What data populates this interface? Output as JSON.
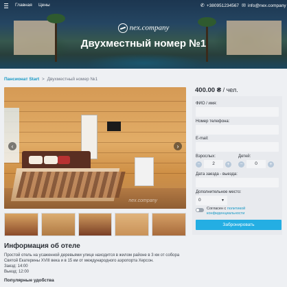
{
  "nav": {
    "home": "Главная",
    "prices": "Цены",
    "phone": "+380951234567",
    "email": "info@nex.company"
  },
  "logo": {
    "text": "nex.company"
  },
  "hero": {
    "title": "Двухместный номер №1"
  },
  "breadcrumb": {
    "link": "Пансионат Start",
    "separator": ">",
    "current": "Двухместный номер №1"
  },
  "gallery": {
    "watermark": "nex.company",
    "prev_icon": "‹",
    "next_icon": "›"
  },
  "booking": {
    "price": "400.00 ₴",
    "per": "/ чел.",
    "name_label": "ФИО / имя:",
    "phone_label": "Номер телефона:",
    "email_label": "E-mail:",
    "adults_label": "Взрослых:",
    "adults_value": "2",
    "children_label": "Детей:",
    "children_value": "0",
    "dates_label": "Дата заезда - выезда:",
    "extra_label": "Дополнительное место:",
    "extra_value": "0",
    "consent_text": "Согласен с",
    "consent_link1": "политикой",
    "consent_link2": "конфиденциальности",
    "submit": "Забронировать",
    "minus": "−",
    "plus": "+"
  },
  "info": {
    "title": "Информация об отеле",
    "description": "Простой отель на усаженной деревьями улице находится в жилом районе в 3 км от собора Святой Екатерины XVIII века и в 15 км от международного аэропорта Херсон.",
    "checkin": "Заезд: 14:00",
    "checkout": "Выезд: 12:00",
    "amenities_title": "Популярные удобства"
  },
  "colors": {
    "accent": "#24aee3",
    "link": "#1597c4",
    "form_bg": "#e8eaee"
  }
}
